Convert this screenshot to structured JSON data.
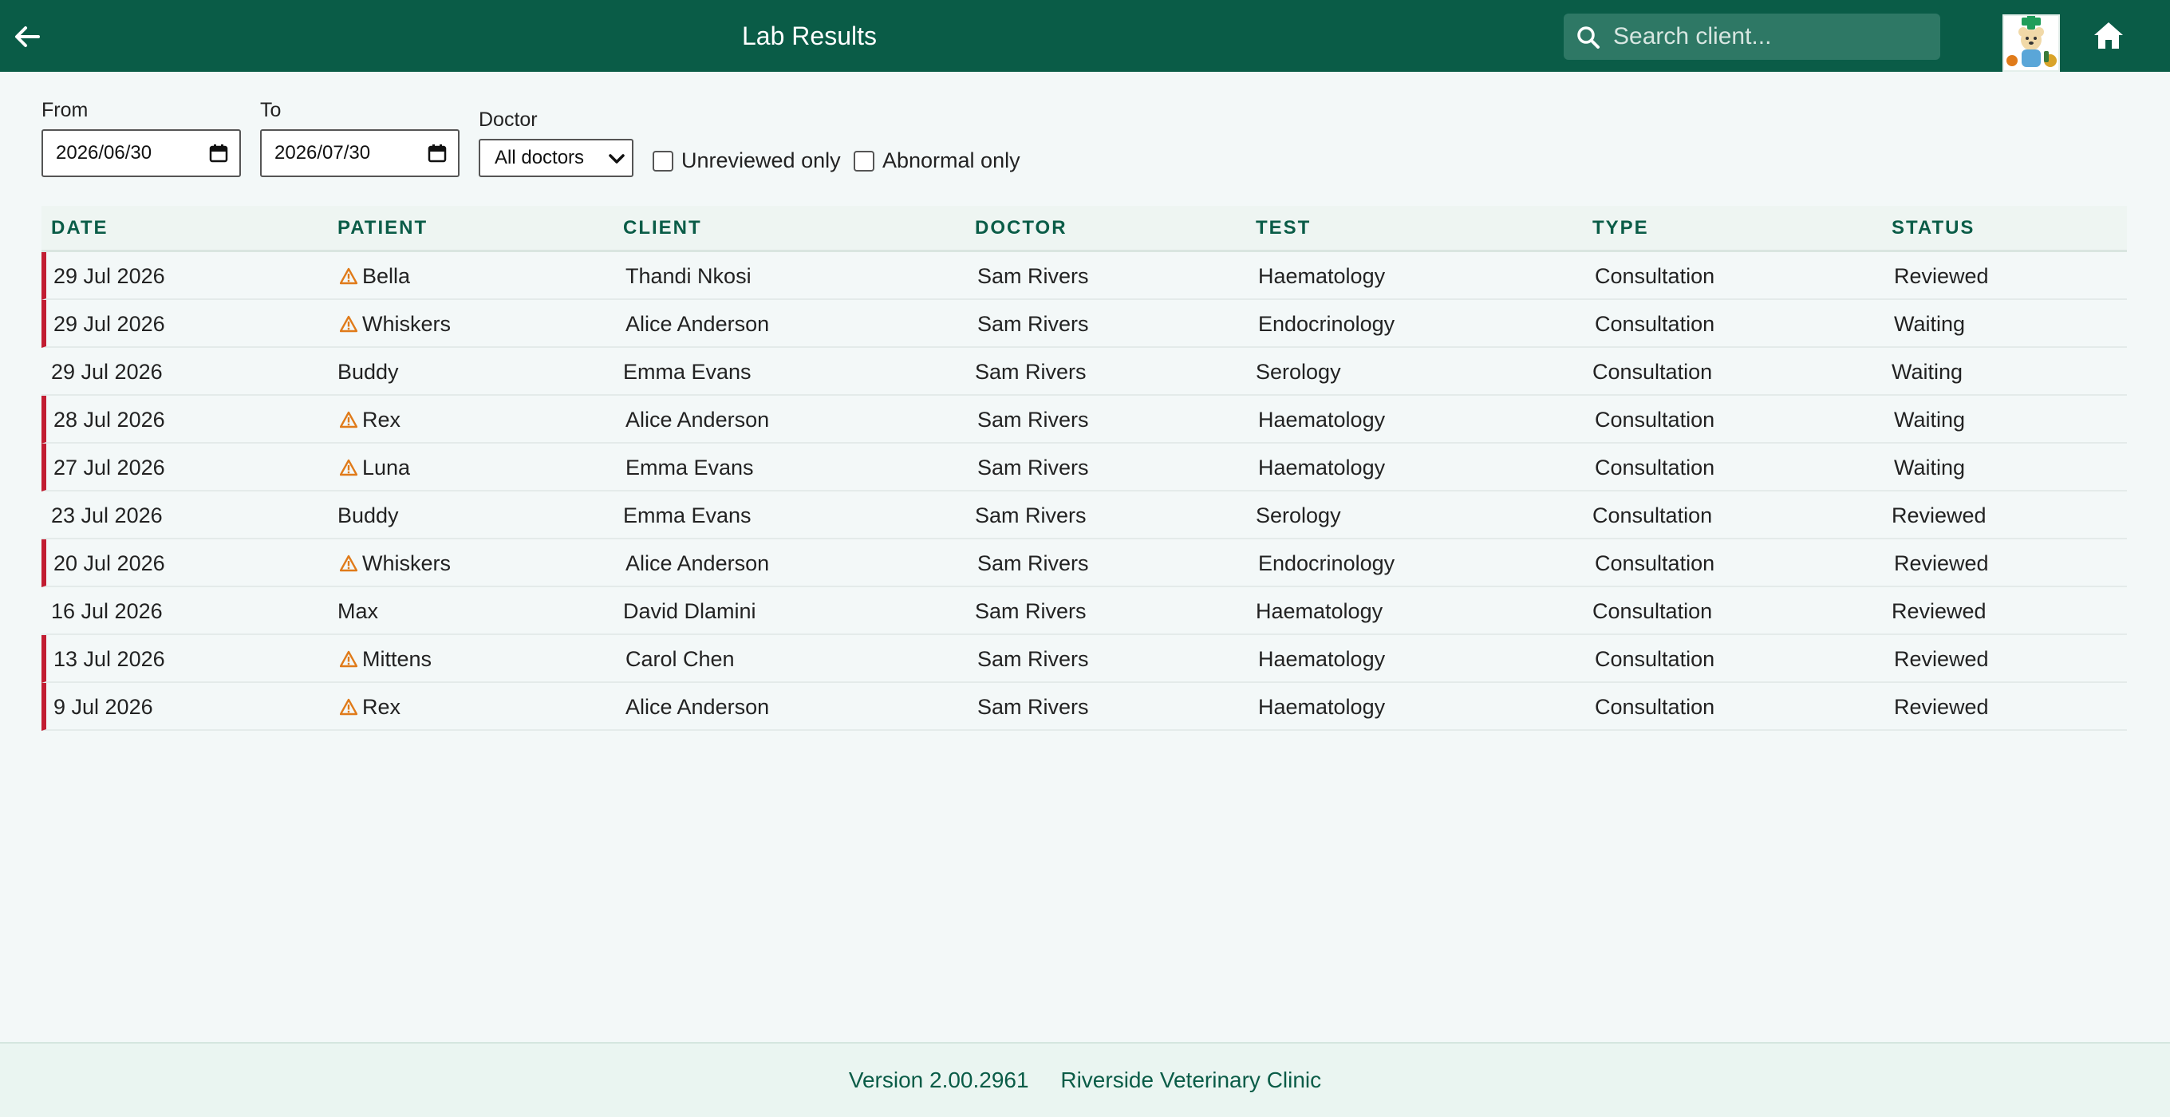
{
  "header": {
    "title": "Lab Results",
    "search_placeholder": "Search client...",
    "icons": {
      "back": "arrow-left-icon",
      "search": "search-icon",
      "home": "home-icon",
      "avatar": "clinic-logo"
    }
  },
  "filters": {
    "from_label": "From",
    "from_value": "2026/06/30",
    "to_label": "To",
    "to_value": "2026/07/30",
    "doctor_label": "Doctor",
    "doctor_value": "All doctors",
    "unreviewed_label": "Unreviewed only",
    "unreviewed_checked": false,
    "abnormal_label": "Abnormal only",
    "abnormal_checked": false
  },
  "table": {
    "columns": [
      "DATE",
      "PATIENT",
      "CLIENT",
      "DOCTOR",
      "TEST",
      "TYPE",
      "STATUS"
    ],
    "rows": [
      {
        "date": "29 Jul 2026",
        "patient": "Bella",
        "client": "Thandi Nkosi",
        "doctor": "Sam Rivers",
        "test": "Haematology",
        "type": "Consultation",
        "status": "Reviewed",
        "abnormal": true
      },
      {
        "date": "29 Jul 2026",
        "patient": "Whiskers",
        "client": "Alice Anderson",
        "doctor": "Sam Rivers",
        "test": "Endocrinology",
        "type": "Consultation",
        "status": "Waiting",
        "abnormal": true
      },
      {
        "date": "29 Jul 2026",
        "patient": "Buddy",
        "client": "Emma Evans",
        "doctor": "Sam Rivers",
        "test": "Serology",
        "type": "Consultation",
        "status": "Waiting",
        "abnormal": false
      },
      {
        "date": "28 Jul 2026",
        "patient": "Rex",
        "client": "Alice Anderson",
        "doctor": "Sam Rivers",
        "test": "Haematology",
        "type": "Consultation",
        "status": "Waiting",
        "abnormal": true
      },
      {
        "date": "27 Jul 2026",
        "patient": "Luna",
        "client": "Emma Evans",
        "doctor": "Sam Rivers",
        "test": "Haematology",
        "type": "Consultation",
        "status": "Waiting",
        "abnormal": true
      },
      {
        "date": "23 Jul 2026",
        "patient": "Buddy",
        "client": "Emma Evans",
        "doctor": "Sam Rivers",
        "test": "Serology",
        "type": "Consultation",
        "status": "Reviewed",
        "abnormal": false
      },
      {
        "date": "20 Jul 2026",
        "patient": "Whiskers",
        "client": "Alice Anderson",
        "doctor": "Sam Rivers",
        "test": "Endocrinology",
        "type": "Consultation",
        "status": "Reviewed",
        "abnormal": true
      },
      {
        "date": "16 Jul 2026",
        "patient": "Max",
        "client": "David Dlamini",
        "doctor": "Sam Rivers",
        "test": "Haematology",
        "type": "Consultation",
        "status": "Reviewed",
        "abnormal": false
      },
      {
        "date": "13 Jul 2026",
        "patient": "Mittens",
        "client": "Carol Chen",
        "doctor": "Sam Rivers",
        "test": "Haematology",
        "type": "Consultation",
        "status": "Reviewed",
        "abnormal": true
      },
      {
        "date": "9 Jul 2026",
        "patient": "Rex",
        "client": "Alice Anderson",
        "doctor": "Sam Rivers",
        "test": "Haematology",
        "type": "Consultation",
        "status": "Reviewed",
        "abnormal": true
      }
    ]
  },
  "footer": {
    "version": "Version 2.00.2961",
    "clinic": "Riverside Veterinary Clinic"
  },
  "colors": {
    "header_bg": "#0a5c47",
    "accent": "#0a5c47",
    "abnormal_marker": "#c21d32",
    "warning_icon": "#e07b1a"
  }
}
